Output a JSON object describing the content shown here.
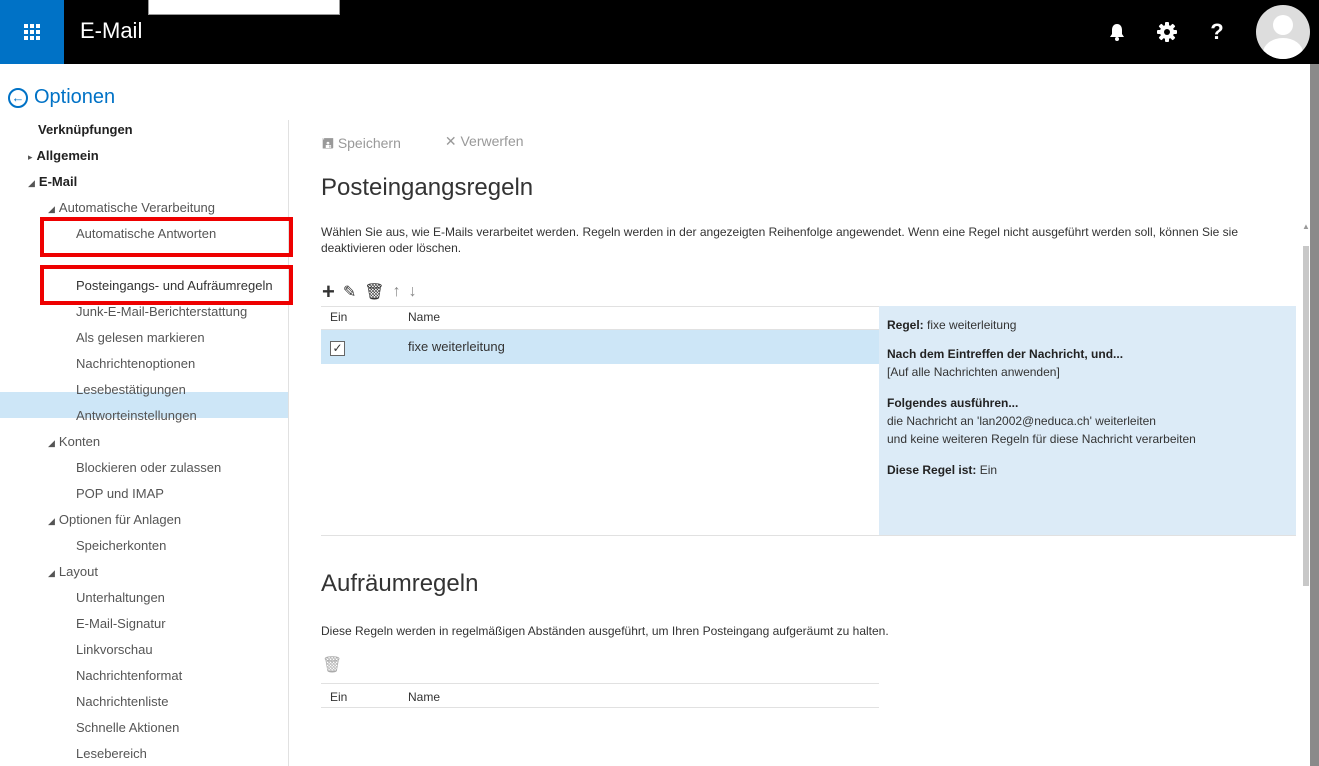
{
  "header": {
    "app_title": "E-Mail",
    "icons": [
      "app-launcher-icon",
      "bell-icon",
      "gear-icon",
      "help-icon",
      "avatar-icon"
    ],
    "help_label": "?"
  },
  "options": {
    "back_label": "Optionen"
  },
  "nav": {
    "shortcuts": "Verknüpfungen",
    "general": "Allgemein",
    "email": "E-Mail",
    "auto_processing": "Automatische Verarbeitung",
    "auto_replies": "Automatische Antworten",
    "inbox_rules": "Posteingangs- und Aufräumregeln",
    "junk": "Junk-E-Mail-Berichterstattung",
    "mark_read": "Als gelesen markieren",
    "msg_options": "Nachrichtenoptionen",
    "read_receipts": "Lesebestätigungen",
    "reply_settings": "Antworteinstellungen",
    "accounts": "Konten",
    "block_allow": "Blockieren oder zulassen",
    "pop_imap": "POP und IMAP",
    "attachment_options": "Optionen für Anlagen",
    "storage_accounts": "Speicherkonten",
    "layout": "Layout",
    "conversations": "Unterhaltungen",
    "signature": "E-Mail-Signatur",
    "link_preview": "Linkvorschau",
    "msg_format": "Nachrichtenformat",
    "msg_list": "Nachrichtenliste",
    "quick_actions": "Schnelle Aktionen",
    "reading_pane": "Lesebereich"
  },
  "toolbar": {
    "save": "Speichern",
    "discard": "Verwerfen"
  },
  "inbox_rules": {
    "title": "Posteingangsregeln",
    "description": "Wählen Sie aus, wie E-Mails verarbeitet werden. Regeln werden in der angezeigten Reihenfolge angewendet. Wenn eine Regel nicht ausgeführt werden soll, können Sie sie deaktivieren oder löschen.",
    "col_on": "Ein",
    "col_name": "Name",
    "rows": [
      {
        "enabled": true,
        "name": "fixe weiterleitung"
      }
    ],
    "details": {
      "rule_label": "Regel:",
      "rule_value": "fixe weiterleitung",
      "after_label": "Nach dem Eintreffen der Nachricht, und...",
      "after_value": "[Auf alle Nachrichten anwenden]",
      "do_label": "Folgendes ausführen...",
      "do_value1": "die Nachricht an 'lan2002@neduca.ch' weiterleiten",
      "do_value2": "und keine weiteren Regeln für diese Nachricht verarbeiten",
      "status_label": "Diese Regel ist:",
      "status_value": "Ein"
    }
  },
  "sweep_rules": {
    "title": "Aufräumregeln",
    "description": "Diese Regeln werden in regelmäßigen Abständen ausgeführt, um Ihren Posteingang aufgeräumt zu halten.",
    "col_on": "Ein",
    "col_name": "Name"
  }
}
